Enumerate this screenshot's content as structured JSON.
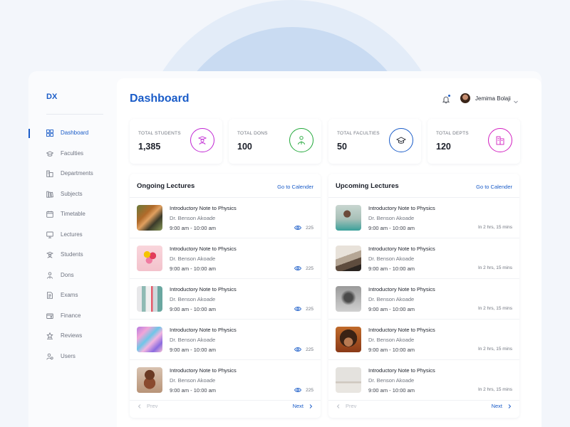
{
  "app": {
    "logo": "DX"
  },
  "sidebar": {
    "items": [
      {
        "label": "Dashboard",
        "icon": "dashboard-icon",
        "active": true
      },
      {
        "label": "Faculties",
        "icon": "graduation-cap-icon"
      },
      {
        "label": "Departments",
        "icon": "departments-icon"
      },
      {
        "label": "Subjects",
        "icon": "books-icon"
      },
      {
        "label": "Timetable",
        "icon": "calendar-icon"
      },
      {
        "label": "Lectures",
        "icon": "lecture-screen-icon"
      },
      {
        "label": "Students",
        "icon": "students-icon"
      },
      {
        "label": "Dons",
        "icon": "dons-icon"
      },
      {
        "label": "Exams",
        "icon": "exam-paper-icon"
      },
      {
        "label": "Finance",
        "icon": "finance-icon"
      },
      {
        "label": "Reviews",
        "icon": "reviews-icon"
      },
      {
        "label": "Users",
        "icon": "users-icon"
      }
    ]
  },
  "header": {
    "title": "Dashboard",
    "user_name": "Jemima Bolaji"
  },
  "stats": [
    {
      "label": "TOTAL STUDENTS",
      "value": "1,385",
      "icon": "student-icon",
      "color": "#c026d3"
    },
    {
      "label": "TOTAL DONS",
      "value": "100",
      "icon": "teacher-icon",
      "color": "#22a83a"
    },
    {
      "label": "TOTAL FACULTIES",
      "value": "50",
      "icon": "graduation-cap-icon",
      "color": "#1a5cc8"
    },
    {
      "label": "TOTAL DEPTS",
      "value": "120",
      "icon": "building-icon",
      "color": "#d21fc0"
    }
  ],
  "ongoing": {
    "title": "Ongoing Lectures",
    "link": "Go to Calender",
    "items": [
      {
        "title": "Introductory Note to Physics",
        "lecturer": "Dr. Benson Akoade",
        "time": "9:00 am - 10:00 am",
        "views": "225",
        "thumb": "tiger"
      },
      {
        "title": "Introductory Note to Physics",
        "lecturer": "Dr. Benson Akoade",
        "time": "9:00 am - 10:00 am",
        "views": "225",
        "thumb": "flowers"
      },
      {
        "title": "Introductory Note to Physics",
        "lecturer": "Dr. Benson Akoade",
        "time": "9:00 am - 10:00 am",
        "views": "225",
        "thumb": "abstract-shapes"
      },
      {
        "title": "Introductory Note to Physics",
        "lecturer": "Dr. Benson Akoade",
        "time": "9:00 am - 10:00 am",
        "views": "225",
        "thumb": "marble-swirl"
      },
      {
        "title": "Introductory Note to Physics",
        "lecturer": "Dr. Benson Akoade",
        "time": "9:00 am - 10:00 am",
        "views": "225",
        "thumb": "donuts"
      }
    ],
    "prev": "Prev",
    "next": "Next"
  },
  "upcoming": {
    "title": "Upcoming Lectures",
    "link": "Go to Calender",
    "items": [
      {
        "title": "Introductory Note to Physics",
        "lecturer": "Dr. Benson Akoade",
        "time": "9:00 am - 10:00 am",
        "eta": "In 2 hrs, 15 mins",
        "thumb": "woman-laptop"
      },
      {
        "title": "Introductory Note to Physics",
        "lecturer": "Dr. Benson Akoade",
        "time": "9:00 am - 10:00 am",
        "eta": "In 2 hrs, 15 mins",
        "thumb": "room-chair"
      },
      {
        "title": "Introductory Note to Physics",
        "lecturer": "Dr. Benson Akoade",
        "time": "9:00 am - 10:00 am",
        "eta": "In 2 hrs, 15 mins",
        "thumb": "bare-tree"
      },
      {
        "title": "Introductory Note to Physics",
        "lecturer": "Dr. Benson Akoade",
        "time": "9:00 am - 10:00 am",
        "eta": "In 2 hrs, 15 mins",
        "thumb": "portrait"
      },
      {
        "title": "Introductory Note to Physics",
        "lecturer": "Dr. Benson Akoade",
        "time": "9:00 am - 10:00 am",
        "eta": "In 2 hrs, 15 mins",
        "thumb": "desk"
      }
    ],
    "prev": "Prev",
    "next": "Next"
  }
}
